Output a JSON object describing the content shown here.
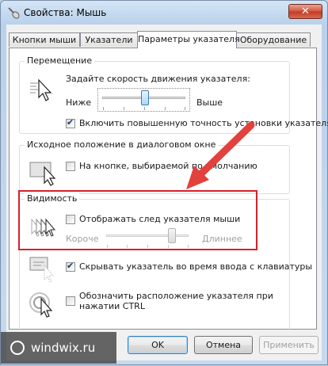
{
  "window": {
    "title": "Свойства: Мышь",
    "close_label": "✕"
  },
  "tabs": [
    {
      "label": "Кнопки мыши",
      "active": false
    },
    {
      "label": "Указатели",
      "active": false
    },
    {
      "label": "Параметры указателя",
      "active": true
    },
    {
      "label": "Оборудование",
      "active": false
    }
  ],
  "motion": {
    "group_title": "Перемещение",
    "speed_label": "Задайте скорость движения указателя:",
    "slow_label": "Ниже",
    "fast_label": "Выше",
    "speed_value_fraction": 0.5,
    "precision_label": "Включить повышенную точность установки указателя",
    "precision_checked": true
  },
  "snap": {
    "group_title": "Исходное положение в диалоговом окне",
    "snap_label": "На кнопке, выбираемой по умолчанию",
    "snap_checked": false
  },
  "visibility": {
    "group_title": "Видимость",
    "trails_label": "Отображать след указателя мыши",
    "trails_checked": false,
    "short_label": "Короче",
    "long_label": "Длиннее",
    "trail_length_fraction": 0.83,
    "hide_label": "Скрывать указатель во время ввода с клавиатуры",
    "hide_checked": true,
    "ctrl_label": "Обозначить расположение указателя при нажатии CTRL",
    "ctrl_checked": false
  },
  "buttons": {
    "ok": "OK",
    "cancel": "Отмена",
    "apply": "Применить"
  },
  "watermark": {
    "text": "windwix.ru"
  },
  "colors": {
    "highlight_box": "#d8202c",
    "arrow": "#e2413d"
  }
}
